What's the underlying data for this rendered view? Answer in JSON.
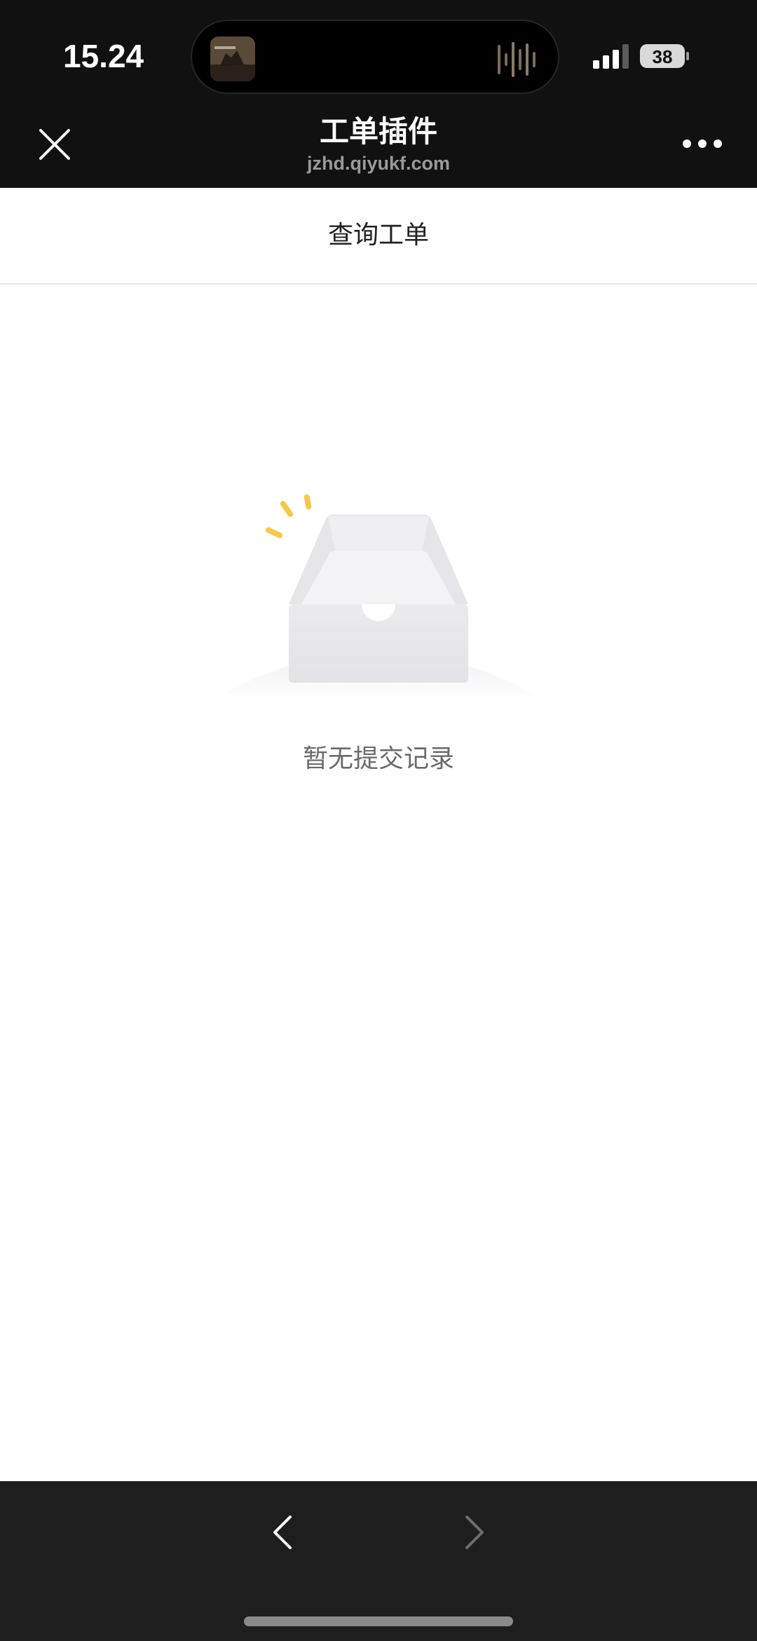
{
  "status_bar": {
    "time": "15.24",
    "battery_level": "38",
    "signal_bars_active": 3,
    "signal_bars_total": 4
  },
  "dynamic_island": {
    "album_art_icon": "album-art-thumbnail",
    "waveform_icon": "audio-waveform-icon"
  },
  "nav_bar": {
    "title": "工单插件",
    "subtitle": "jzhd.qiyukf.com",
    "close_icon": "close-icon",
    "more_icon": "more-dots-icon"
  },
  "page_header": {
    "title": "查询工单"
  },
  "empty_state": {
    "illustration": "empty-box-icon",
    "message": "暂无提交记录"
  },
  "browser_toolbar": {
    "back_icon": "chevron-left-icon",
    "forward_icon": "chevron-right-icon"
  },
  "colors": {
    "top_background": "#111111",
    "bottom_background": "#1e1e1e",
    "page_background": "#ffffff",
    "sparkle_accent": "#f7c948"
  }
}
